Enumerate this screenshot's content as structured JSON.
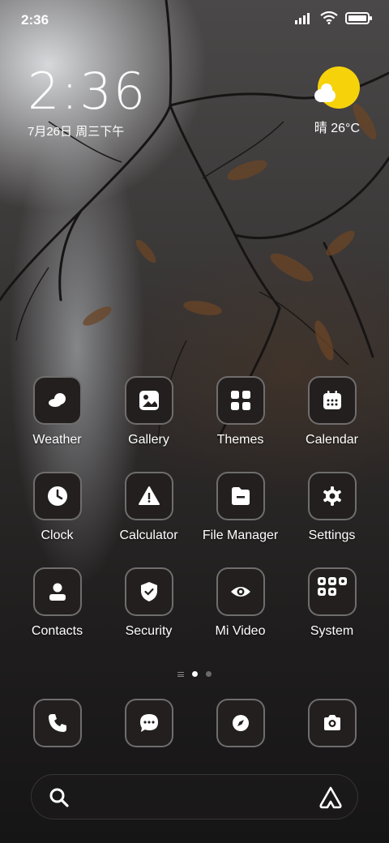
{
  "status_bar": {
    "time": "2:36"
  },
  "clock_widget": {
    "time": "2:36",
    "date": "7月26日 周三下午"
  },
  "weather_widget": {
    "condition_temp": "晴 26°C",
    "icon": "sun-cloud-icon",
    "sun_color": "#f6d20a"
  },
  "apps": [
    {
      "label": "Weather",
      "icon": "weather-icon"
    },
    {
      "label": "Gallery",
      "icon": "gallery-icon"
    },
    {
      "label": "Themes",
      "icon": "themes-icon"
    },
    {
      "label": "Calendar",
      "icon": "calendar-icon"
    },
    {
      "label": "Clock",
      "icon": "clock-icon"
    },
    {
      "label": "Calculator",
      "icon": "calculator-icon"
    },
    {
      "label": "File Manager",
      "icon": "file-manager-icon"
    },
    {
      "label": "Settings",
      "icon": "settings-icon"
    },
    {
      "label": "Contacts",
      "icon": "contacts-icon"
    },
    {
      "label": "Security",
      "icon": "security-icon"
    },
    {
      "label": "Mi Video",
      "icon": "mi-video-icon"
    },
    {
      "label": "System",
      "icon": "folder-icon"
    }
  ],
  "dock": [
    {
      "icon": "phone-icon"
    },
    {
      "icon": "messages-icon"
    },
    {
      "icon": "browser-compass-icon"
    },
    {
      "icon": "camera-icon"
    }
  ],
  "page_indicator": {
    "pages": 2,
    "active": 1
  },
  "search_bar": {
    "left_icon": "search-icon",
    "right_icon": "assistant-icon"
  }
}
